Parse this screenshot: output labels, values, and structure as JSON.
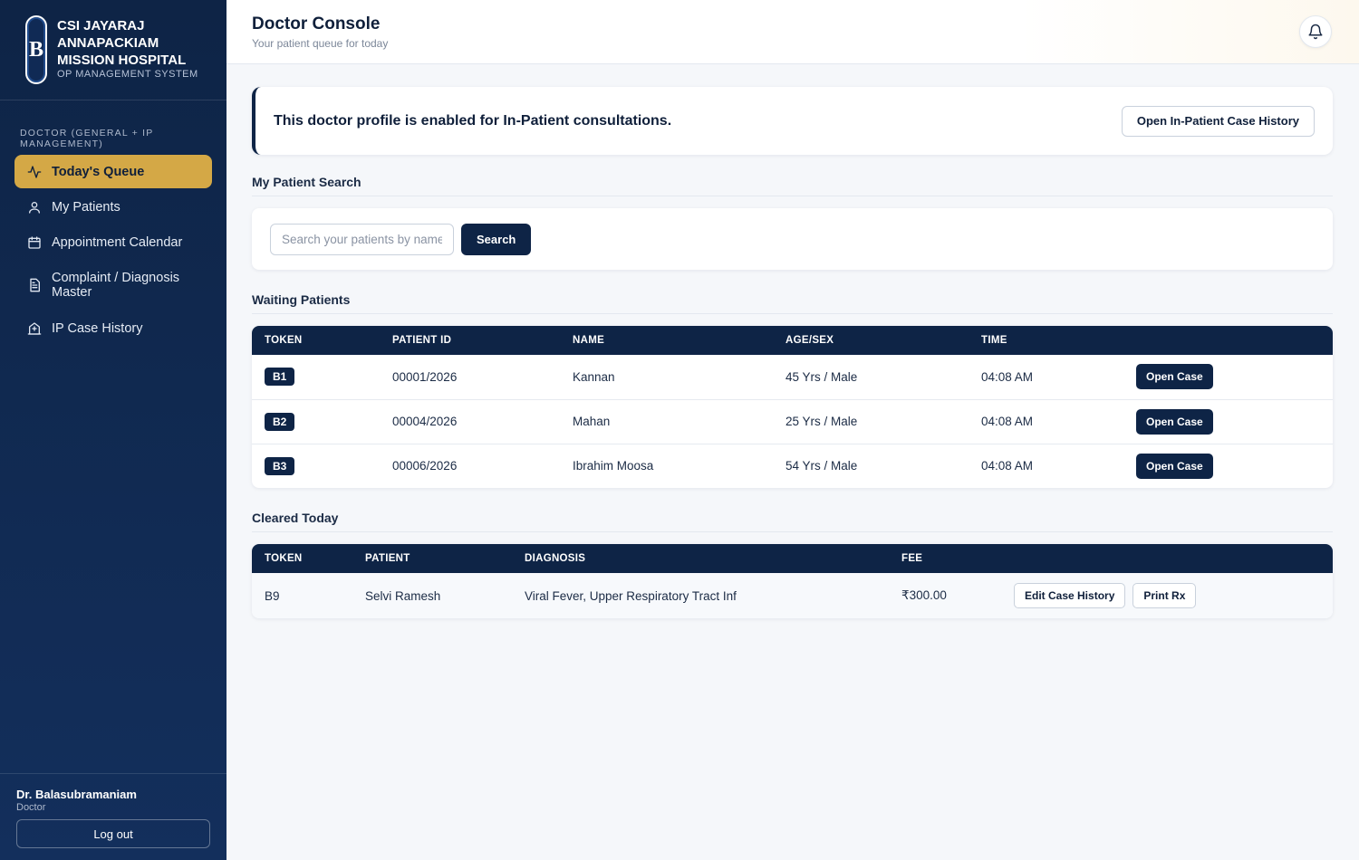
{
  "brand": {
    "logo_letter": "B",
    "name": "CSI JAYARAJ ANNAPACKIAM MISSION HOSPITAL",
    "subtitle": "OP MANAGEMENT SYSTEM"
  },
  "sidebar": {
    "role_label": "DOCTOR (GENERAL + IP MANAGEMENT)",
    "items": [
      {
        "label": "Today's Queue",
        "icon": "activity-icon",
        "active": true
      },
      {
        "label": "My Patients",
        "icon": "user-icon"
      },
      {
        "label": "Appointment Calendar",
        "icon": "calendar-icon"
      },
      {
        "label": "Complaint / Diagnosis Master",
        "icon": "document-icon"
      },
      {
        "label": "IP Case History",
        "icon": "hospital-icon"
      }
    ],
    "user": {
      "name": "Dr. Balasubramaniam",
      "role": "Doctor"
    },
    "logout_label": "Log out"
  },
  "header": {
    "title": "Doctor Console",
    "subtitle": "Your patient queue for today",
    "bell_icon": "bell-icon"
  },
  "ip_banner": {
    "text": "This doctor profile is enabled for In-Patient consultations.",
    "button_label": "Open In-Patient Case History"
  },
  "search": {
    "section_title": "My Patient Search",
    "placeholder": "Search your patients by name",
    "button_label": "Search"
  },
  "waiting": {
    "section_title": "Waiting Patients",
    "columns": [
      "TOKEN",
      "PATIENT ID",
      "NAME",
      "AGE/SEX",
      "TIME"
    ],
    "action_label": "Open Case",
    "rows": [
      {
        "token": "B1",
        "patient_id": "00001/2026",
        "name": "Kannan",
        "age_sex": "45 Yrs / Male",
        "time": "04:08 AM"
      },
      {
        "token": "B2",
        "patient_id": "00004/2026",
        "name": "Mahan",
        "age_sex": "25 Yrs / Male",
        "time": "04:08 AM"
      },
      {
        "token": "B3",
        "patient_id": "00006/2026",
        "name": "Ibrahim Moosa",
        "age_sex": "54 Yrs / Male",
        "time": "04:08 AM"
      }
    ]
  },
  "cleared": {
    "section_title": "Cleared Today",
    "columns": [
      "TOKEN",
      "PATIENT",
      "DIAGNOSIS",
      "FEE"
    ],
    "edit_label": "Edit Case History",
    "print_label": "Print Rx",
    "rows": [
      {
        "token": "B9",
        "patient": "Selvi Ramesh",
        "diagnosis": "Viral Fever, Upper Respiratory Tract Inf",
        "fee": "₹300.00"
      }
    ]
  },
  "colors": {
    "sidebar_bg": "#0e2446",
    "accent": "#d4a846",
    "primary": "#0e2446"
  }
}
